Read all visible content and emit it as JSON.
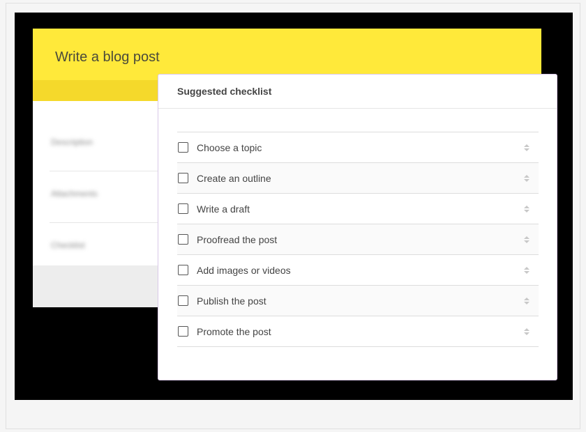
{
  "card": {
    "title": "Write a blog post",
    "blurred_rows": [
      "Description",
      "Attachments",
      "Checklist"
    ]
  },
  "checklist": {
    "title": "Suggested checklist",
    "items": [
      {
        "label": "Choose a topic",
        "checked": false
      },
      {
        "label": "Create an outline",
        "checked": false
      },
      {
        "label": "Write a draft",
        "checked": false
      },
      {
        "label": "Proofread the post",
        "checked": false
      },
      {
        "label": "Add images or videos",
        "checked": false
      },
      {
        "label": "Publish the post",
        "checked": false
      },
      {
        "label": "Promote the post",
        "checked": false
      }
    ]
  },
  "colors": {
    "header": "#ffe93a",
    "overlay": "#000000",
    "panel_border": "#d9c8e8"
  },
  "icons": {
    "checkbox": "checkbox-icon",
    "drag": "sort-handle-icon"
  }
}
